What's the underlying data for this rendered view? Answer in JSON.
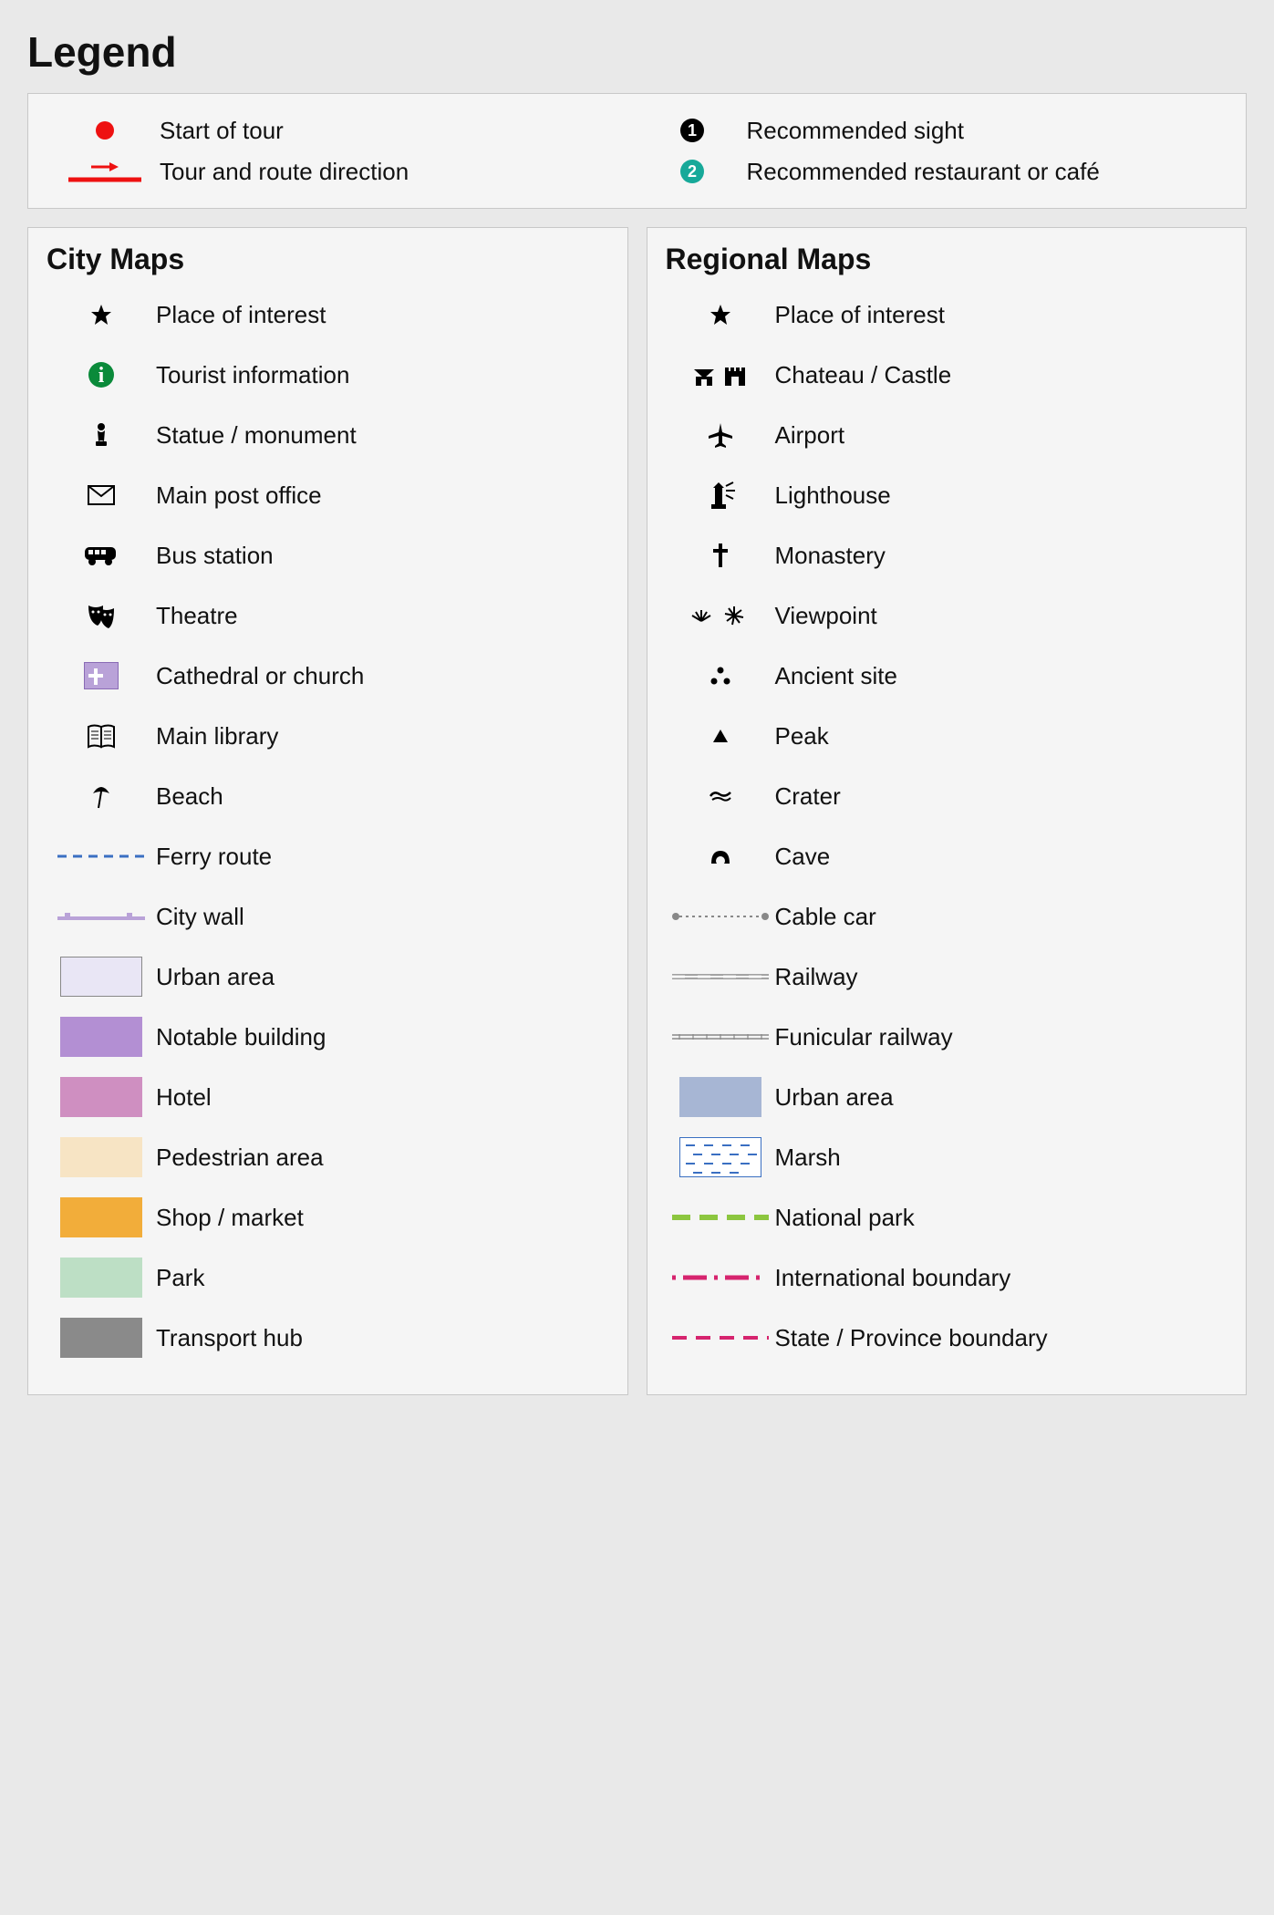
{
  "title": "Legend",
  "top": [
    {
      "name": "start-of-tour",
      "label": "Start of tour"
    },
    {
      "name": "recommended-sight",
      "label": "Recommended sight"
    },
    {
      "name": "tour-route-direction",
      "label": "Tour and route direction"
    },
    {
      "name": "recommended-restaurant",
      "label": "Recommended restaurant or café"
    }
  ],
  "city": {
    "heading": "City Maps",
    "items": [
      {
        "name": "place-of-interest",
        "label": "Place of interest"
      },
      {
        "name": "tourist-information",
        "label": "Tourist information"
      },
      {
        "name": "statue-monument",
        "label": "Statue / monument"
      },
      {
        "name": "main-post-office",
        "label": "Main post office"
      },
      {
        "name": "bus-station",
        "label": "Bus station"
      },
      {
        "name": "theatre",
        "label": "Theatre"
      },
      {
        "name": "cathedral-church",
        "label": "Cathedral or church"
      },
      {
        "name": "main-library",
        "label": "Main library"
      },
      {
        "name": "beach",
        "label": "Beach"
      },
      {
        "name": "ferry-route",
        "label": "Ferry route"
      },
      {
        "name": "city-wall",
        "label": "City wall"
      },
      {
        "name": "urban-area-city",
        "label": "Urban area"
      },
      {
        "name": "notable-building",
        "label": "Notable building"
      },
      {
        "name": "hotel",
        "label": "Hotel"
      },
      {
        "name": "pedestrian-area",
        "label": "Pedestrian area"
      },
      {
        "name": "shop-market",
        "label": "Shop / market"
      },
      {
        "name": "park",
        "label": "Park"
      },
      {
        "name": "transport-hub",
        "label": "Transport hub"
      }
    ]
  },
  "regional": {
    "heading": "Regional Maps",
    "items": [
      {
        "name": "place-of-interest-regional",
        "label": "Place of interest"
      },
      {
        "name": "chateau-castle",
        "label": "Chateau / Castle"
      },
      {
        "name": "airport",
        "label": "Airport"
      },
      {
        "name": "lighthouse",
        "label": "Lighthouse"
      },
      {
        "name": "monastery",
        "label": "Monastery"
      },
      {
        "name": "viewpoint",
        "label": "Viewpoint"
      },
      {
        "name": "ancient-site",
        "label": "Ancient site"
      },
      {
        "name": "peak",
        "label": "Peak"
      },
      {
        "name": "crater",
        "label": "Crater"
      },
      {
        "name": "cave",
        "label": "Cave"
      },
      {
        "name": "cable-car",
        "label": "Cable car"
      },
      {
        "name": "railway",
        "label": "Railway"
      },
      {
        "name": "funicular-railway",
        "label": "Funicular railway"
      },
      {
        "name": "urban-area-regional",
        "label": "Urban area"
      },
      {
        "name": "marsh",
        "label": "Marsh"
      },
      {
        "name": "national-park",
        "label": "National park"
      },
      {
        "name": "international-boundary",
        "label": "International boundary"
      },
      {
        "name": "state-province-boundary",
        "label": "State / Province boundary"
      }
    ]
  },
  "colors": {
    "urban_city": "#e9e6f5",
    "notable_building": "#b38fd3",
    "hotel": "#cf8fc1",
    "pedestrian": "#f7e4c4",
    "shop": "#f2ad3a",
    "park": "#bddfc5",
    "transport_hub": "#8a8a8a",
    "urban_regional": "#a7b6d4",
    "marsh_bg": "#ffffff",
    "national_park": "#8cc63f",
    "boundary": "#d6246e",
    "ferry": "#3a6fc2",
    "city_wall": "#b9a2d8",
    "cable": "#888"
  }
}
